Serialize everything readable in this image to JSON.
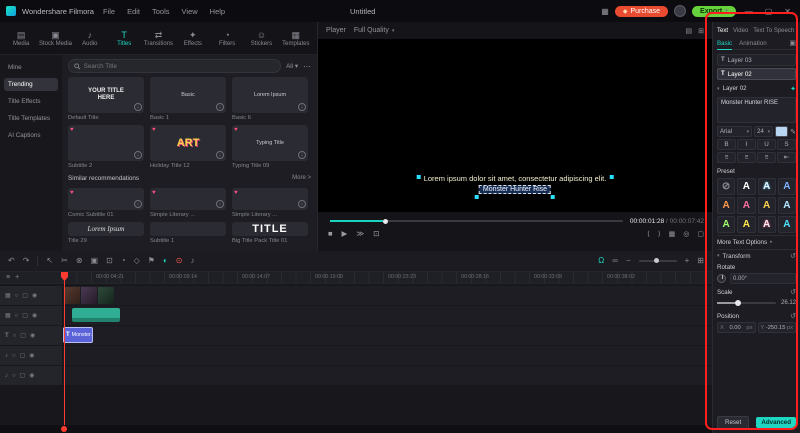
{
  "titlebar": {
    "app_name": "Wondershare Filmora",
    "menus": [
      "File",
      "Edit",
      "Tools",
      "View",
      "Help"
    ],
    "project_title": "Untitled",
    "purchase_label": "Purchase",
    "export_label": "Export"
  },
  "media_tabs": {
    "items": [
      {
        "label": "Media"
      },
      {
        "label": "Stock Media"
      },
      {
        "label": "Audio"
      },
      {
        "label": "Titles"
      },
      {
        "label": "Transitions"
      },
      {
        "label": "Effects"
      },
      {
        "label": "Filters"
      },
      {
        "label": "Stickers"
      },
      {
        "label": "Templates"
      }
    ]
  },
  "sidebar": {
    "items": [
      {
        "label": "Mine"
      },
      {
        "label": "Trending"
      },
      {
        "label": "Title Effects"
      },
      {
        "label": "Title Templates"
      },
      {
        "label": "AI Captions"
      }
    ]
  },
  "library": {
    "search_placeholder": "Search Title",
    "filter_all": "All",
    "section_header": "Similar recommendations",
    "more_label": "More >",
    "cards": [
      {
        "preview": "YOUR TITLE HERE",
        "label": "Default Title"
      },
      {
        "preview": "Basic",
        "label": "Basic 1"
      },
      {
        "preview": "Lorem Ipsum",
        "label": "Basic 6"
      },
      {
        "preview": "",
        "label": "Subtitle 2"
      },
      {
        "preview": "ART",
        "label": "Holiday Title 12"
      },
      {
        "preview": "Typing Title",
        "label": "Typing Title 09"
      },
      {
        "preview": "",
        "label": "Comic Subtitle 01"
      },
      {
        "preview": "",
        "label": "Simple Literary ..."
      },
      {
        "preview": "",
        "label": "Simple Literary ..."
      },
      {
        "preview": "Lorem Ipsum",
        "label": "Title 29"
      },
      {
        "preview": "",
        "label": "Subtitle 1"
      },
      {
        "preview": "TITLE",
        "label": "Big Title Pack Title 01"
      }
    ]
  },
  "player": {
    "label": "Player",
    "quality": "Full Quality",
    "overlay_line1": "Lorem ipsum dolor sit amet, consectetur adipiscing elit.",
    "overlay_line2": "Monster Hunter Rise",
    "timecode_current": "00:00:01:28",
    "timecode_total": " / 00:00:07:42"
  },
  "properties": {
    "tabs": [
      {
        "label": "Text"
      },
      {
        "label": "Video"
      },
      {
        "label": "Text To Speech"
      }
    ],
    "subtabs": [
      {
        "label": "Basic"
      },
      {
        "label": "Animation"
      }
    ],
    "layers": [
      {
        "label": "Layer 03"
      },
      {
        "label": "Layer 02"
      }
    ],
    "layer_header": "Layer 02",
    "text_value": "Monster Hunter RISE",
    "font_family": "Arial",
    "font_size": "24",
    "style_bold": "B",
    "style_italic": "I",
    "style_underline": "U",
    "style_strike": "S",
    "preset_label": "Preset",
    "presets": [
      {
        "glyph": "⊘",
        "css": "color:#8a8a92"
      },
      {
        "glyph": "A",
        "css": "color:#ffffff"
      },
      {
        "glyph": "A",
        "css": "color:#e9f6ff;text-shadow:0 0 2px #4fd8ff"
      },
      {
        "glyph": "A",
        "css": "color:#7fb3ff"
      },
      {
        "glyph": "A",
        "css": "color:#ff9a4d"
      },
      {
        "glyph": "A",
        "css": "color:#ff6d9d"
      },
      {
        "glyph": "A",
        "css": "color:#ffd24d"
      },
      {
        "glyph": "A",
        "css": "color:#b0e8ff"
      },
      {
        "glyph": "A",
        "css": "color:#9dff6d"
      },
      {
        "glyph": "A",
        "css": "color:#ffe94d"
      },
      {
        "glyph": "A",
        "css": "color:#f0f0f0;text-shadow:0 0 2px #ff4d8a"
      },
      {
        "glyph": "A",
        "css": "color:#4de0ff"
      }
    ],
    "more_text_options": "More Text Options",
    "transform_label": "Transform",
    "rotate_label": "Rotate",
    "rotate_value": "0.00°",
    "scale_label": "Scale",
    "scale_value": "26.12",
    "position_label": "Position",
    "pos_x_label": "X",
    "pos_x": "0.00",
    "pos_y_label": "Y",
    "pos_y": "-250.15",
    "unit_px": "px",
    "reset_label": "Reset",
    "advanced_label": "Advanced"
  },
  "timeline": {
    "ruler": [
      "00:00:04:21",
      "00:00:09:14",
      "00:00:14:07",
      "00:00:19:00",
      "00:00:23:23",
      "00:00:28:16",
      "00:00:33:09",
      "00:00:38:02"
    ],
    "text_clip_label": "Monster..."
  }
}
